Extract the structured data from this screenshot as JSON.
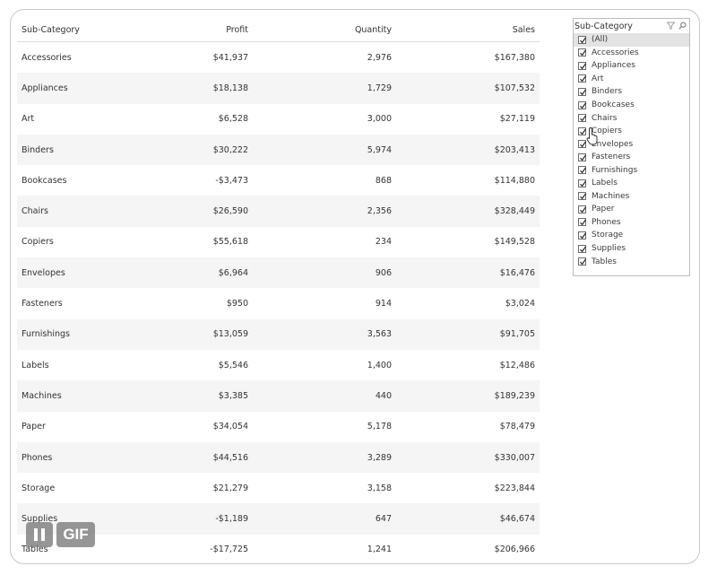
{
  "table": {
    "headers": [
      "Sub-Category",
      "Profit",
      "Quantity",
      "Sales"
    ],
    "rows": [
      [
        "Accessories",
        "$41,937",
        "2,976",
        "$167,380"
      ],
      [
        "Appliances",
        "$18,138",
        "1,729",
        "$107,532"
      ],
      [
        "Art",
        "$6,528",
        "3,000",
        "$27,119"
      ],
      [
        "Binders",
        "$30,222",
        "5,974",
        "$203,413"
      ],
      [
        "Bookcases",
        "-$3,473",
        "868",
        "$114,880"
      ],
      [
        "Chairs",
        "$26,590",
        "2,356",
        "$328,449"
      ],
      [
        "Copiers",
        "$55,618",
        "234",
        "$149,528"
      ],
      [
        "Envelopes",
        "$6,964",
        "906",
        "$16,476"
      ],
      [
        "Fasteners",
        "$950",
        "914",
        "$3,024"
      ],
      [
        "Furnishings",
        "$13,059",
        "3,563",
        "$91,705"
      ],
      [
        "Labels",
        "$5,546",
        "1,400",
        "$12,486"
      ],
      [
        "Machines",
        "$3,385",
        "440",
        "$189,239"
      ],
      [
        "Paper",
        "$34,054",
        "5,178",
        "$78,479"
      ],
      [
        "Phones",
        "$44,516",
        "3,289",
        "$330,007"
      ],
      [
        "Storage",
        "$21,279",
        "3,158",
        "$223,844"
      ],
      [
        "Supplies",
        "-$1,189",
        "647",
        "$46,674"
      ],
      [
        "Tables",
        "-$17,725",
        "1,241",
        "$206,966"
      ]
    ]
  },
  "filter": {
    "title": "Sub-Category",
    "head_icons": [
      "filter-icon",
      "search-icon"
    ],
    "options": [
      {
        "label": "(All)",
        "checked": true
      },
      {
        "label": "Accessories",
        "checked": true
      },
      {
        "label": "Appliances",
        "checked": true
      },
      {
        "label": "Art",
        "checked": true
      },
      {
        "label": "Binders",
        "checked": true
      },
      {
        "label": "Bookcases",
        "checked": true
      },
      {
        "label": "Chairs",
        "checked": true
      },
      {
        "label": "Copiers",
        "checked": true
      },
      {
        "label": "Envelopes",
        "checked": true
      },
      {
        "label": "Fasteners",
        "checked": true
      },
      {
        "label": "Furnishings",
        "checked": true
      },
      {
        "label": "Labels",
        "checked": true
      },
      {
        "label": "Machines",
        "checked": true
      },
      {
        "label": "Paper",
        "checked": true
      },
      {
        "label": "Phones",
        "checked": true
      },
      {
        "label": "Storage",
        "checked": true
      },
      {
        "label": "Supplies",
        "checked": true
      },
      {
        "label": "Tables",
        "checked": true
      }
    ]
  },
  "player": {
    "pause_icon": "pause-icon",
    "gif_label": "GIF"
  }
}
